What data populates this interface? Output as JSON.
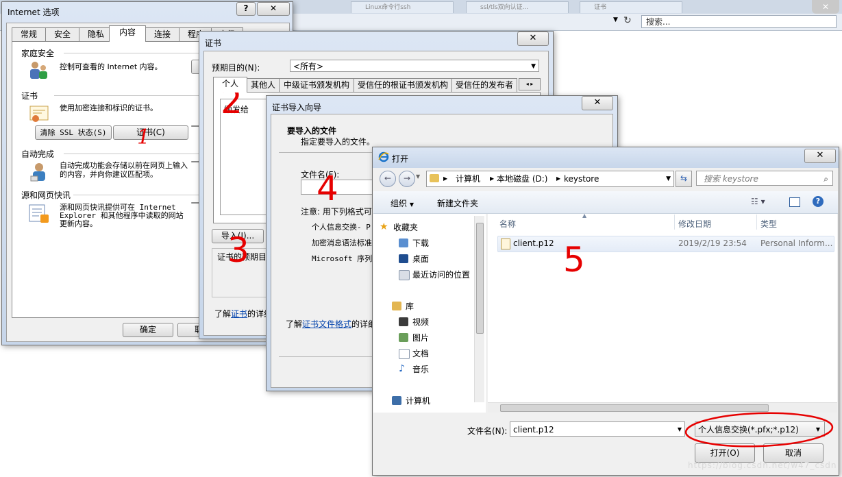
{
  "browser": {
    "tab_titles": [
      "Linux命令行ssh",
      "ssl/tls双向认证...",
      "证书"
    ],
    "search_placeholder": "搜索..."
  },
  "inet": {
    "title": "Internet 选项",
    "help": "?",
    "close": "✕",
    "tabs": [
      "常规",
      "安全",
      "隐私",
      "内容",
      "连接",
      "程序",
      "高级"
    ],
    "family": {
      "heading": "家庭安全",
      "text": "控制可查看的 Internet 内容。"
    },
    "certs": {
      "heading": "证书",
      "text": "使用加密连接和标识的证书。",
      "clear_ssl": "清除 SSL 状态(S)",
      "certs_button": "证书(C)"
    },
    "autocomplete": {
      "heading": "自动完成",
      "text": "自动完成功能会存储以前在网页上输入的内容，并向你建议匹配项。"
    },
    "feeds": {
      "heading": "源和网页快讯",
      "text": "源和网页快讯提供可在 Internet Explorer 和其他程序中读取的网站更新内容。"
    },
    "ok": "确定",
    "cancel": "取消"
  },
  "certmgr": {
    "title": "证书",
    "close": "✕",
    "purpose_label": "预期目的(N):",
    "purpose_value": "<所有>",
    "tabs": [
      "个人",
      "其他人",
      "中级证书颁发机构",
      "受信任的根证书颁发机构",
      "受信任的发布者"
    ],
    "col_issued_to": "颁发给",
    "import": "导入(I)...",
    "purposes_label": "证书的预期目",
    "learn_prefix": "了解",
    "learn_link": "证书",
    "learn_suffix": "的详细"
  },
  "wizard": {
    "title": "证书导入向导",
    "close": "✕",
    "heading": "要导入的文件",
    "subheading": "指定要导入的文件。",
    "filename_label": "文件名(F):",
    "note": "注意: 用下列格式可",
    "formats": [
      "个人信息交换- P",
      "加密消息语法标准",
      "Microsoft 序列化"
    ],
    "learn_prefix": "了解",
    "learn_link": "证书文件格式",
    "learn_suffix": "的详细"
  },
  "open": {
    "title": "打开",
    "close": "✕",
    "breadcrumb": [
      "计算机",
      "本地磁盘 (D:)",
      "keystore"
    ],
    "search_placeholder": "搜索 keystore",
    "organize": "组织",
    "new_folder": "新建文件夹",
    "nav": {
      "favorites": "收藏夹",
      "downloads": "下载",
      "desktop": "桌面",
      "recent": "最近访问的位置",
      "libraries": "库",
      "videos": "视频",
      "pictures": "图片",
      "documents": "文档",
      "music": "音乐",
      "computer": "计算机"
    },
    "columns": {
      "name": "名称",
      "modified": "修改日期",
      "type": "类型"
    },
    "files": [
      {
        "name": "client.p12",
        "modified": "2019/2/19 23:54",
        "type": "Personal Inform..."
      }
    ],
    "filename_label": "文件名(N):",
    "filename_value": "client.p12",
    "filter": "个人信息交换(*.pfx;*.p12)",
    "open_button": "打开(O)",
    "cancel_button": "取消"
  },
  "annotations": [
    "1",
    "2",
    "3",
    "4",
    "5"
  ],
  "watermark": "https://blog.csdn.net/w47_csdn",
  "colors": {
    "annotation": "#e60000",
    "link": "#0645ad",
    "selection": "#dbe7f7"
  }
}
